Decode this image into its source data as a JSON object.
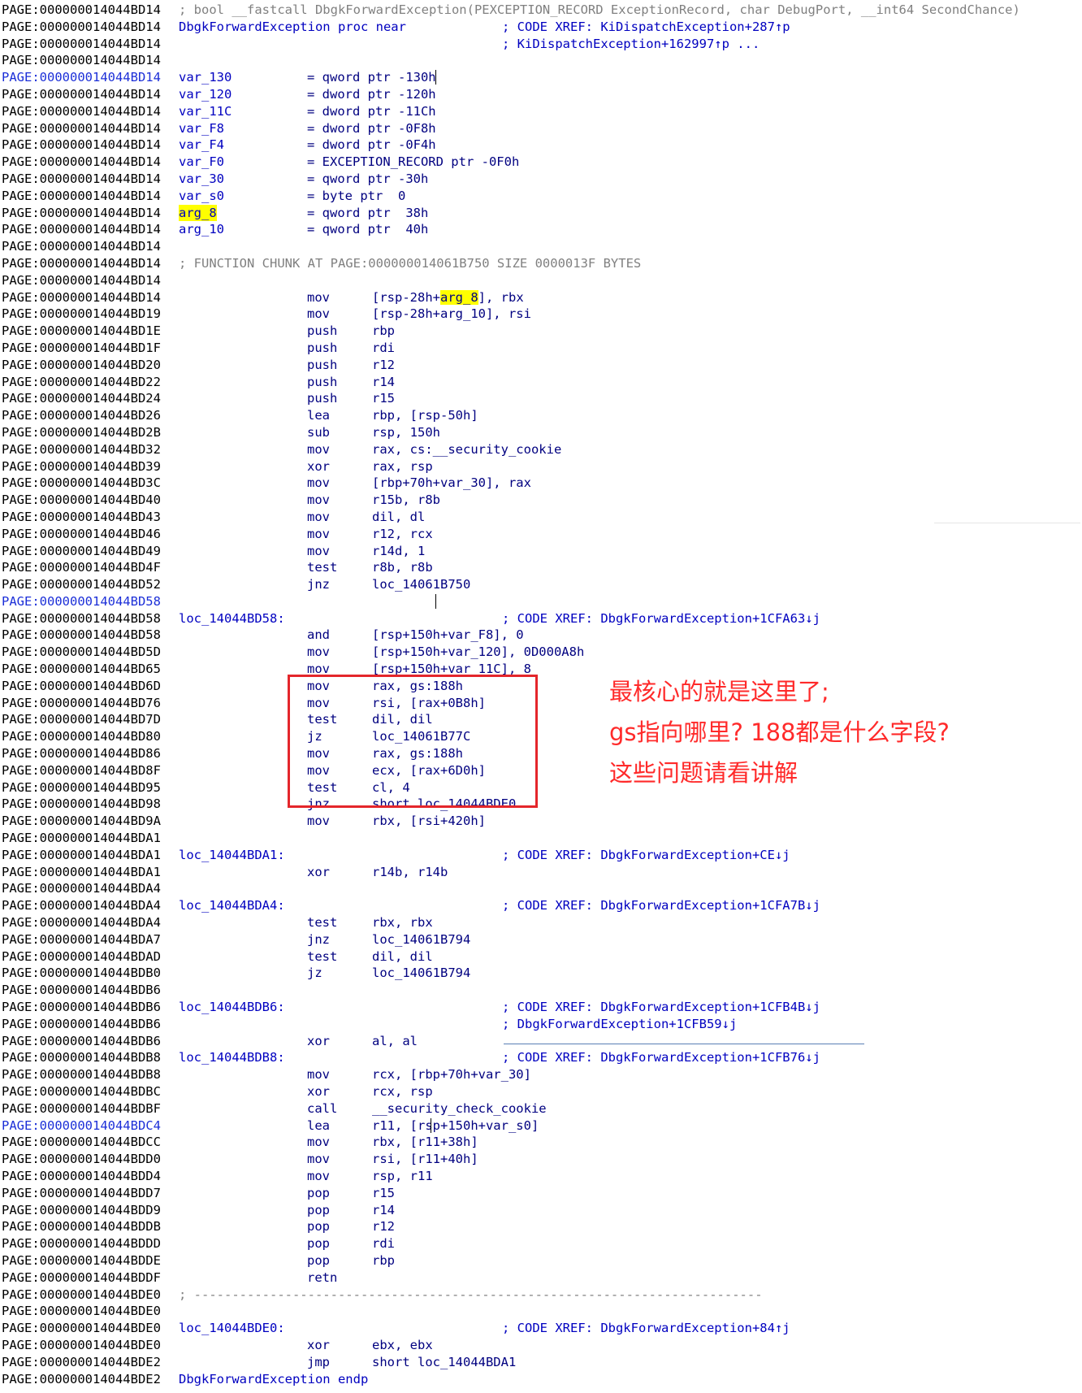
{
  "lines": [
    {
      "addr": "PAGE:000000014044BD14",
      "full": "; bool __fastcall DbgkForwardException(PEXCEPTION_RECORD ExceptionRecord, char DebugPort, __int64 SecondChance)",
      "full_style": "comment"
    },
    {
      "addr": "PAGE:000000014044BD14",
      "label": "DbgkForwardException proc near",
      "comment": "; CODE XREF: KiDispatchException+287↑p"
    },
    {
      "addr": "PAGE:000000014044BD14",
      "comment": "; KiDispatchException+162997↑p ..."
    },
    {
      "addr": "PAGE:000000014044BD14"
    },
    {
      "addr": "PAGE:000000014044BD14",
      "selected": true,
      "label": "var_130",
      "mnemonic": "= qword ptr -130h"
    },
    {
      "addr": "PAGE:000000014044BD14",
      "label": "var_120",
      "mnemonic": "= dword ptr -120h"
    },
    {
      "addr": "PAGE:000000014044BD14",
      "label": "var_11C",
      "mnemonic": "= dword ptr -11Ch"
    },
    {
      "addr": "PAGE:000000014044BD14",
      "label": "var_F8",
      "mnemonic": "= dword ptr -0F8h"
    },
    {
      "addr": "PAGE:000000014044BD14",
      "label": "var_F4",
      "mnemonic": "= dword ptr -0F4h"
    },
    {
      "addr": "PAGE:000000014044BD14",
      "label": "var_F0",
      "mnemonic": "= EXCEPTION_RECORD ptr -0F0h"
    },
    {
      "addr": "PAGE:000000014044BD14",
      "label": "var_30",
      "mnemonic": "= qword ptr -30h"
    },
    {
      "addr": "PAGE:000000014044BD14",
      "label": "var_s0",
      "mnemonic": "= byte ptr  0"
    },
    {
      "addr": "PAGE:000000014044BD14",
      "label": "arg_8",
      "label_hl": true,
      "mnemonic": "= qword ptr  38h"
    },
    {
      "addr": "PAGE:000000014044BD14",
      "label": "arg_10",
      "mnemonic": "= qword ptr  40h"
    },
    {
      "addr": "PAGE:000000014044BD14"
    },
    {
      "addr": "PAGE:000000014044BD14",
      "full": "; FUNCTION CHUNK AT PAGE:000000014061B750 SIZE 0000013F BYTES",
      "full_style": "chunk"
    },
    {
      "addr": "PAGE:000000014044BD14"
    },
    {
      "addr": "PAGE:000000014044BD14",
      "mnemonic": "mov",
      "op_pre": "[rsp-28h+",
      "op_hl": "arg_8",
      "op_post": "], rbx"
    },
    {
      "addr": "PAGE:000000014044BD19",
      "mnemonic": "mov",
      "operands": "[rsp-28h+arg_10], rsi"
    },
    {
      "addr": "PAGE:000000014044BD1E",
      "mnemonic": "push",
      "operands": "rbp"
    },
    {
      "addr": "PAGE:000000014044BD1F",
      "mnemonic": "push",
      "operands": "rdi"
    },
    {
      "addr": "PAGE:000000014044BD20",
      "mnemonic": "push",
      "operands": "r12"
    },
    {
      "addr": "PAGE:000000014044BD22",
      "mnemonic": "push",
      "operands": "r14"
    },
    {
      "addr": "PAGE:000000014044BD24",
      "mnemonic": "push",
      "operands": "r15"
    },
    {
      "addr": "PAGE:000000014044BD26",
      "mnemonic": "lea",
      "operands": "rbp, [rsp-50h]"
    },
    {
      "addr": "PAGE:000000014044BD2B",
      "mnemonic": "sub",
      "operands": "rsp, 150h"
    },
    {
      "addr": "PAGE:000000014044BD32",
      "mnemonic": "mov",
      "operands": "rax, cs:__security_cookie"
    },
    {
      "addr": "PAGE:000000014044BD39",
      "mnemonic": "xor",
      "operands": "rax, rsp"
    },
    {
      "addr": "PAGE:000000014044BD3C",
      "mnemonic": "mov",
      "operands": "[rbp+70h+var_30], rax"
    },
    {
      "addr": "PAGE:000000014044BD40",
      "mnemonic": "mov",
      "operands": "r15b, r8b"
    },
    {
      "addr": "PAGE:000000014044BD43",
      "mnemonic": "mov",
      "operands": "dil, dl"
    },
    {
      "addr": "PAGE:000000014044BD46",
      "mnemonic": "mov",
      "operands": "r12, rcx"
    },
    {
      "addr": "PAGE:000000014044BD49",
      "mnemonic": "mov",
      "operands": "r14d, 1"
    },
    {
      "addr": "PAGE:000000014044BD4F",
      "mnemonic": "test",
      "operands": "r8b, r8b"
    },
    {
      "addr": "PAGE:000000014044BD52",
      "mnemonic": "jnz",
      "operands": "loc_14061B750"
    },
    {
      "addr": "PAGE:000000014044BD58",
      "selected": true
    },
    {
      "addr": "PAGE:000000014044BD58",
      "label": "loc_14044BD58:",
      "comment": "; CODE XREF: DbgkForwardException+1CFA63↓j"
    },
    {
      "addr": "PAGE:000000014044BD58",
      "mnemonic": "and",
      "operands": "[rsp+150h+var_F8], 0"
    },
    {
      "addr": "PAGE:000000014044BD5D",
      "mnemonic": "mov",
      "operands": "[rsp+150h+var_120], 0D000A8h"
    },
    {
      "addr": "PAGE:000000014044BD65",
      "mnemonic": "mov",
      "operands": "[rsp+150h+var_11C], 8"
    },
    {
      "addr": "PAGE:000000014044BD6D",
      "mnemonic": "mov",
      "operands": "rax, gs:188h"
    },
    {
      "addr": "PAGE:000000014044BD76",
      "mnemonic": "mov",
      "operands": "rsi, [rax+0B8h]"
    },
    {
      "addr": "PAGE:000000014044BD7D",
      "mnemonic": "test",
      "operands": "dil, dil"
    },
    {
      "addr": "PAGE:000000014044BD80",
      "mnemonic": "jz",
      "operands": "loc_14061B77C"
    },
    {
      "addr": "PAGE:000000014044BD86",
      "mnemonic": "mov",
      "operands": "rax, gs:188h"
    },
    {
      "addr": "PAGE:000000014044BD8F",
      "mnemonic": "mov",
      "operands": "ecx, [rax+6D0h]"
    },
    {
      "addr": "PAGE:000000014044BD95",
      "mnemonic": "test",
      "operands": "cl, 4"
    },
    {
      "addr": "PAGE:000000014044BD98",
      "mnemonic": "jnz",
      "operands": "short loc_14044BDE0"
    },
    {
      "addr": "PAGE:000000014044BD9A",
      "mnemonic": "mov",
      "operands": "rbx, [rsi+420h]"
    },
    {
      "addr": "PAGE:000000014044BDA1"
    },
    {
      "addr": "PAGE:000000014044BDA1",
      "label": "loc_14044BDA1:",
      "comment": "; CODE XREF: DbgkForwardException+CE↓j"
    },
    {
      "addr": "PAGE:000000014044BDA1",
      "mnemonic": "xor",
      "operands": "r14b, r14b"
    },
    {
      "addr": "PAGE:000000014044BDA4"
    },
    {
      "addr": "PAGE:000000014044BDA4",
      "label": "loc_14044BDA4:",
      "comment": "; CODE XREF: DbgkForwardException+1CFA7B↓j"
    },
    {
      "addr": "PAGE:000000014044BDA4",
      "mnemonic": "test",
      "operands": "rbx, rbx"
    },
    {
      "addr": "PAGE:000000014044BDA7",
      "mnemonic": "jnz",
      "operands": "loc_14061B794"
    },
    {
      "addr": "PAGE:000000014044BDAD",
      "mnemonic": "test",
      "operands": "dil, dil"
    },
    {
      "addr": "PAGE:000000014044BDB0",
      "mnemonic": "jz",
      "operands": "loc_14061B794"
    },
    {
      "addr": "PAGE:000000014044BDB6"
    },
    {
      "addr": "PAGE:000000014044BDB6",
      "label": "loc_14044BDB6:",
      "comment": "; CODE XREF: DbgkForwardException+1CFB4B↓j"
    },
    {
      "addr": "PAGE:000000014044BDB6",
      "comment": "; DbgkForwardException+1CFB59↓j"
    },
    {
      "addr": "PAGE:000000014044BDB6",
      "mnemonic": "xor",
      "operands": "al, al"
    },
    {
      "addr": "PAGE:000000014044BDB8",
      "label": "loc_14044BDB8:",
      "comment": "; CODE XREF: DbgkForwardException+1CFB76↓j"
    },
    {
      "addr": "PAGE:000000014044BDB8",
      "mnemonic": "mov",
      "operands": "rcx, [rbp+70h+var_30]"
    },
    {
      "addr": "PAGE:000000014044BDBC",
      "mnemonic": "xor",
      "operands": "rcx, rsp"
    },
    {
      "addr": "PAGE:000000014044BDBF",
      "mnemonic": "call",
      "operands": "__security_check_cookie"
    },
    {
      "addr": "PAGE:000000014044BDC4",
      "selected": true,
      "mnemonic": "lea",
      "operands": "r11, [rsp+150h+var_s0]"
    },
    {
      "addr": "PAGE:000000014044BDCC",
      "mnemonic": "mov",
      "operands": "rbx, [r11+38h]"
    },
    {
      "addr": "PAGE:000000014044BDD0",
      "mnemonic": "mov",
      "operands": "rsi, [r11+40h]"
    },
    {
      "addr": "PAGE:000000014044BDD4",
      "mnemonic": "mov",
      "operands": "rsp, r11"
    },
    {
      "addr": "PAGE:000000014044BDD7",
      "mnemonic": "pop",
      "operands": "r15"
    },
    {
      "addr": "PAGE:000000014044BDD9",
      "mnemonic": "pop",
      "operands": "r14"
    },
    {
      "addr": "PAGE:000000014044BDDB",
      "mnemonic": "pop",
      "operands": "r12"
    },
    {
      "addr": "PAGE:000000014044BDDD",
      "mnemonic": "pop",
      "operands": "rdi"
    },
    {
      "addr": "PAGE:000000014044BDDE",
      "mnemonic": "pop",
      "operands": "rbp"
    },
    {
      "addr": "PAGE:000000014044BDDF",
      "mnemonic": "retn"
    },
    {
      "addr": "PAGE:000000014044BDE0",
      "full": "; ---------------------------------------------------------------------------",
      "full_style": "separator"
    },
    {
      "addr": "PAGE:000000014044BDE0"
    },
    {
      "addr": "PAGE:000000014044BDE0",
      "label": "loc_14044BDE0:",
      "comment": "; CODE XREF: DbgkForwardException+84↑j"
    },
    {
      "addr": "PAGE:000000014044BDE0",
      "mnemonic": "xor",
      "operands": "ebx, ebx"
    },
    {
      "addr": "PAGE:000000014044BDE2",
      "mnemonic": "jmp",
      "operands": "short loc_14044BDA1"
    },
    {
      "addr": "PAGE:000000014044BDE2",
      "label": "DbgkForwardException endp"
    }
  ],
  "annotation": {
    "lines": [
      "最核心的就是这里了;",
      "gs指向哪里? 188都是什么字段?",
      "这些问题请看讲解"
    ]
  },
  "colors": {
    "annotation": "#ff2a2a",
    "highlight": "#ffff00",
    "selected_address": "#1c2fd8",
    "code": "#000080"
  }
}
